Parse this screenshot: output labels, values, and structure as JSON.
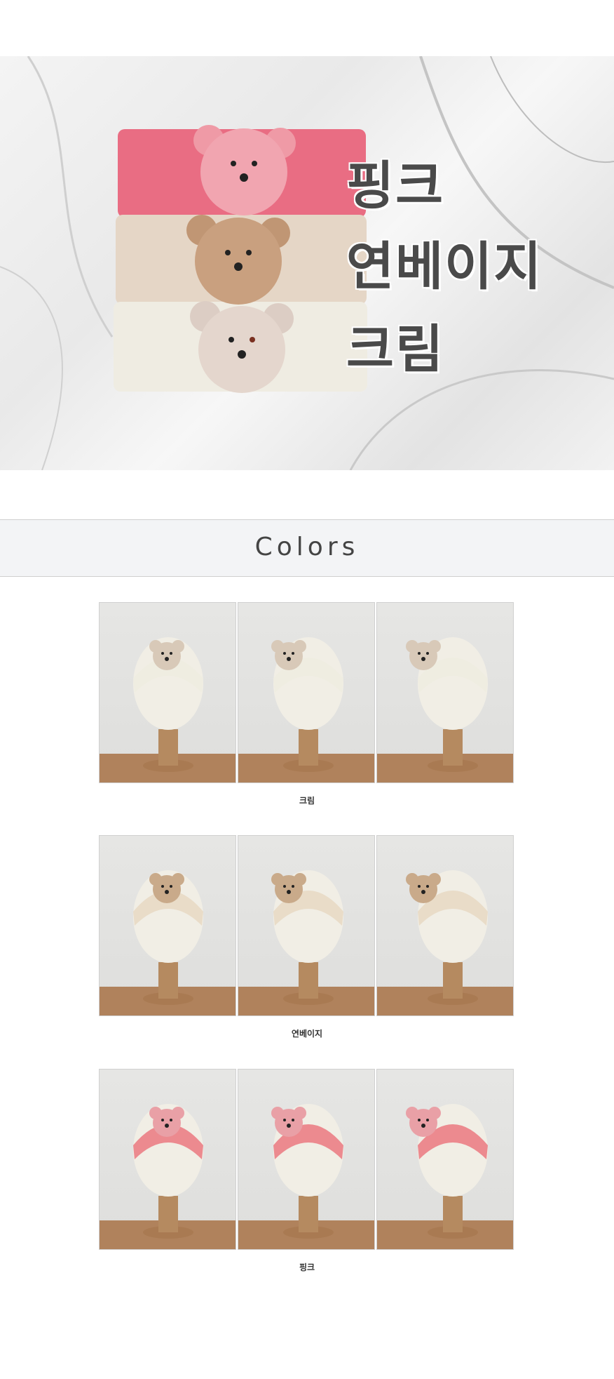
{
  "hero": {
    "labels": [
      "핑크",
      "연베이지",
      "크림"
    ],
    "colors": {
      "pink": "#e96d83",
      "beige": "#e5d6c6",
      "cream": "#efece2"
    }
  },
  "section_title": "Colors",
  "groups": [
    {
      "caption": "크림",
      "band_color": "#efede1",
      "bear_color": "#d8c9b8"
    },
    {
      "caption": "연베이지",
      "band_color": "#e9dcc8",
      "bear_color": "#c9aa8a"
    },
    {
      "caption": "핑크",
      "band_color": "#ec8a8f",
      "bear_color": "#e9a0a6"
    }
  ]
}
